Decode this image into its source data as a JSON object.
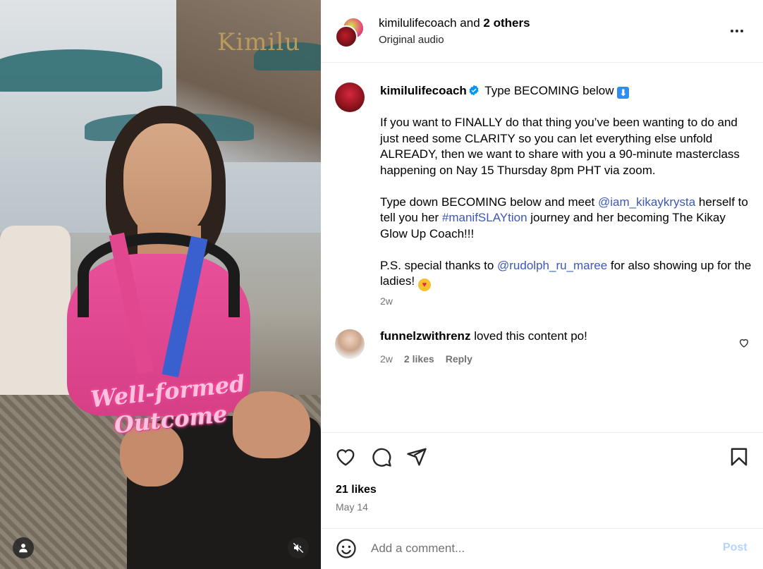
{
  "media": {
    "brand_watermark": "Kimilu",
    "overlay_caption_line1": "Well-formed",
    "overlay_caption_line2": "Outcome",
    "icons": {
      "user": "user-icon",
      "mute": "speaker-muted-icon"
    }
  },
  "header": {
    "username": "kimilulifecoach",
    "collab_prefix": "and",
    "collab_others": "2 others",
    "audio": "Original audio",
    "more_icon": "more-horizontal-icon"
  },
  "post": {
    "username": "kimilulifecoach",
    "headline": "Type BECOMING below",
    "headline_emoji": "⬇",
    "paragraph1": "If you want to FINALLY do that thing you’ve been wanting to do and just need some CLARITY so you can let everything else unfold ALREADY, then we want to share with you a 90-minute masterclass happening on Nay 15 Thursday 8pm PHT via zoom.",
    "p2_a": "Type down BECOMING below and meet ",
    "p2_mention": "@iam_kikaykrysta",
    "p2_b": " herself to tell you her ",
    "p2_hashtag": "#manifSLAYtion",
    "p2_c": " journey and her becoming The Kikay Glow Up Coach!!!",
    "p3_a": "P.S. special thanks to ",
    "p3_mention": "@rudolph_ru_maree",
    "p3_b": " for also showing up for the ladies! ",
    "time": "2w"
  },
  "comment": {
    "username": "funnelzwithrenz",
    "text": "loved this content po!",
    "time": "2w",
    "likes": "2 likes",
    "reply": "Reply"
  },
  "actions": {
    "likes": "21 likes",
    "date": "May 14"
  },
  "add_comment": {
    "placeholder": "Add a comment...",
    "post_label": "Post"
  },
  "colors": {
    "link": "#3d57b8",
    "verified": "#0095f6",
    "muted_text": "#737373",
    "post_button_disabled": "#b3d4fc"
  }
}
